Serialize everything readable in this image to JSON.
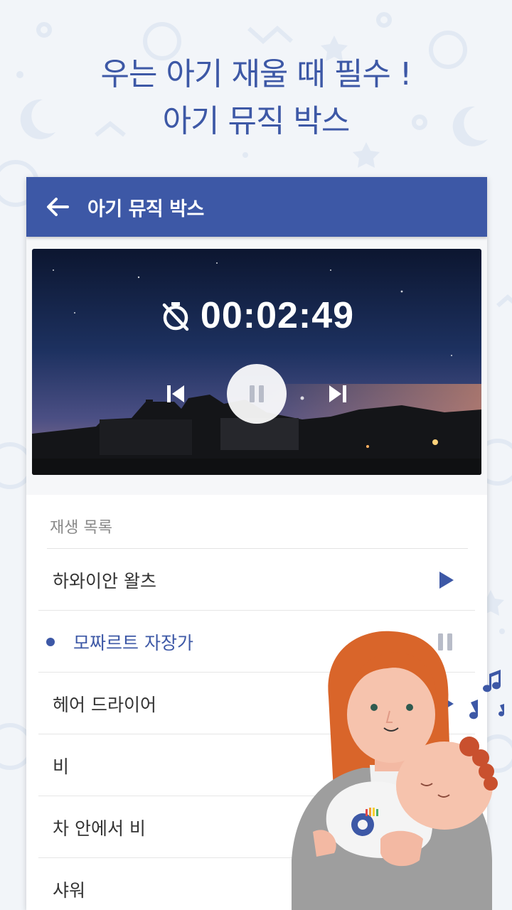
{
  "headline": {
    "line1": "우는 아기 재울 때 필수 !",
    "line2": "아기 뮤직 박스"
  },
  "appbar": {
    "title": "아기 뮤직 박스",
    "back_icon": "arrow-left-icon",
    "color": "#3d58a6"
  },
  "player": {
    "timer": "00:02:49",
    "timer_icon": "timer-off-icon",
    "prev_icon": "skip-previous-icon",
    "pause_icon": "pause-icon",
    "next_icon": "skip-next-icon"
  },
  "playlist": {
    "header": "재생 목록",
    "items": [
      {
        "label": "하와이안 왈츠",
        "state": "play",
        "active": false
      },
      {
        "label": "모짜르트 자장가",
        "state": "pause",
        "active": true
      },
      {
        "label": "헤어 드라이어",
        "state": "play",
        "active": false
      },
      {
        "label": "비",
        "state": "play",
        "active": false
      },
      {
        "label": "차 안에서 비",
        "state": "play",
        "active": false
      },
      {
        "label": "샤워",
        "state": "play",
        "active": false
      }
    ]
  },
  "colors": {
    "accent": "#3d58a6",
    "background": "#f2f5f9",
    "pause_grey": "#b8bcc8"
  }
}
